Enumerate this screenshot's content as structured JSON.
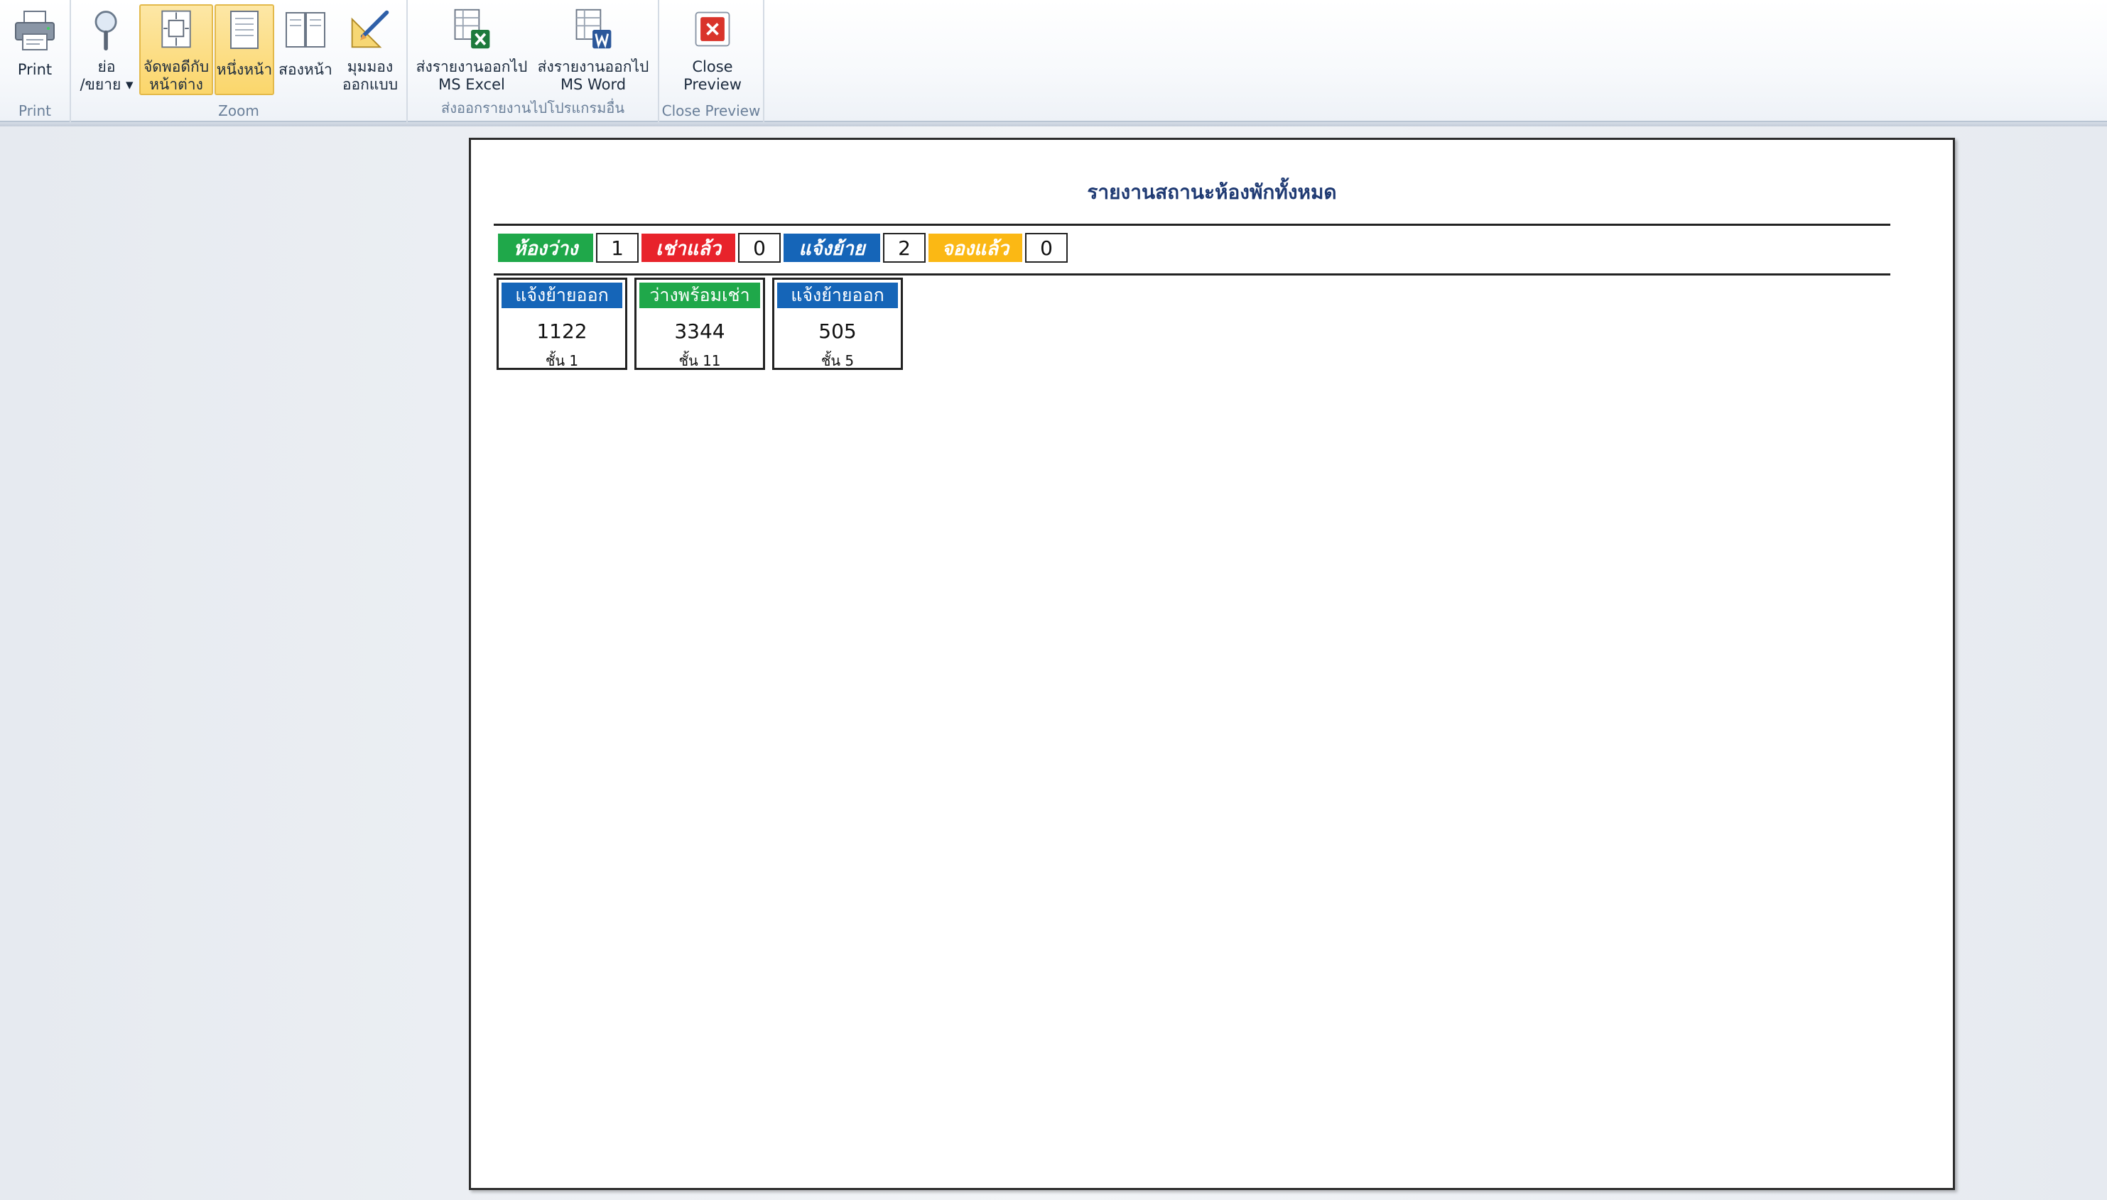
{
  "ribbon": {
    "groups": [
      {
        "id": "print",
        "label": "Print"
      },
      {
        "id": "zoom",
        "label": "Zoom"
      },
      {
        "id": "export",
        "label": "ส่งออกรายงานไปโปรแกรมอื่น"
      },
      {
        "id": "close",
        "label": "Close Preview"
      }
    ],
    "buttons": {
      "print": "Print",
      "zoom": "ย่อ\n/ขยาย ▾",
      "fit_window": "จัดพอดีกับ\nหน้าต่าง",
      "one_page": "หนึ่งหน้า",
      "two_pages": "สองหน้า",
      "design_view": "มุมมอง\nออกแบบ",
      "export_excel": "ส่งรายงานออกไป\nMS Excel",
      "export_word": "ส่งรายงานออกไป\nMS Word",
      "close_preview": "Close\nPreview"
    }
  },
  "colors": {
    "available": "#1fa84a",
    "rented": "#e8232b",
    "moving_out": "#1565b8",
    "reserved": "#fbb814"
  },
  "report": {
    "title": "รายงานสถานะห้องพักทั้งหมด",
    "legend": [
      {
        "label": "ห้องว่าง",
        "count": "1",
        "color": "#1fa84a"
      },
      {
        "label": "เช่าแล้ว",
        "count": "0",
        "color": "#e8232b"
      },
      {
        "label": "แจ้งย้าย",
        "count": "2",
        "color": "#1565b8"
      },
      {
        "label": "จองแล้ว",
        "count": "0",
        "color": "#fbb814"
      }
    ],
    "rooms": [
      {
        "status": "แจ้งย้ายออก",
        "room": "1122",
        "floor": "ชั้น 1",
        "color": "#1565b8"
      },
      {
        "status": "ว่างพร้อมเช่า",
        "room": "3344",
        "floor": "ชั้น 11",
        "color": "#1fa84a"
      },
      {
        "status": "แจ้งย้ายออก",
        "room": "505",
        "floor": "ชั้น 5",
        "color": "#1565b8"
      }
    ]
  }
}
